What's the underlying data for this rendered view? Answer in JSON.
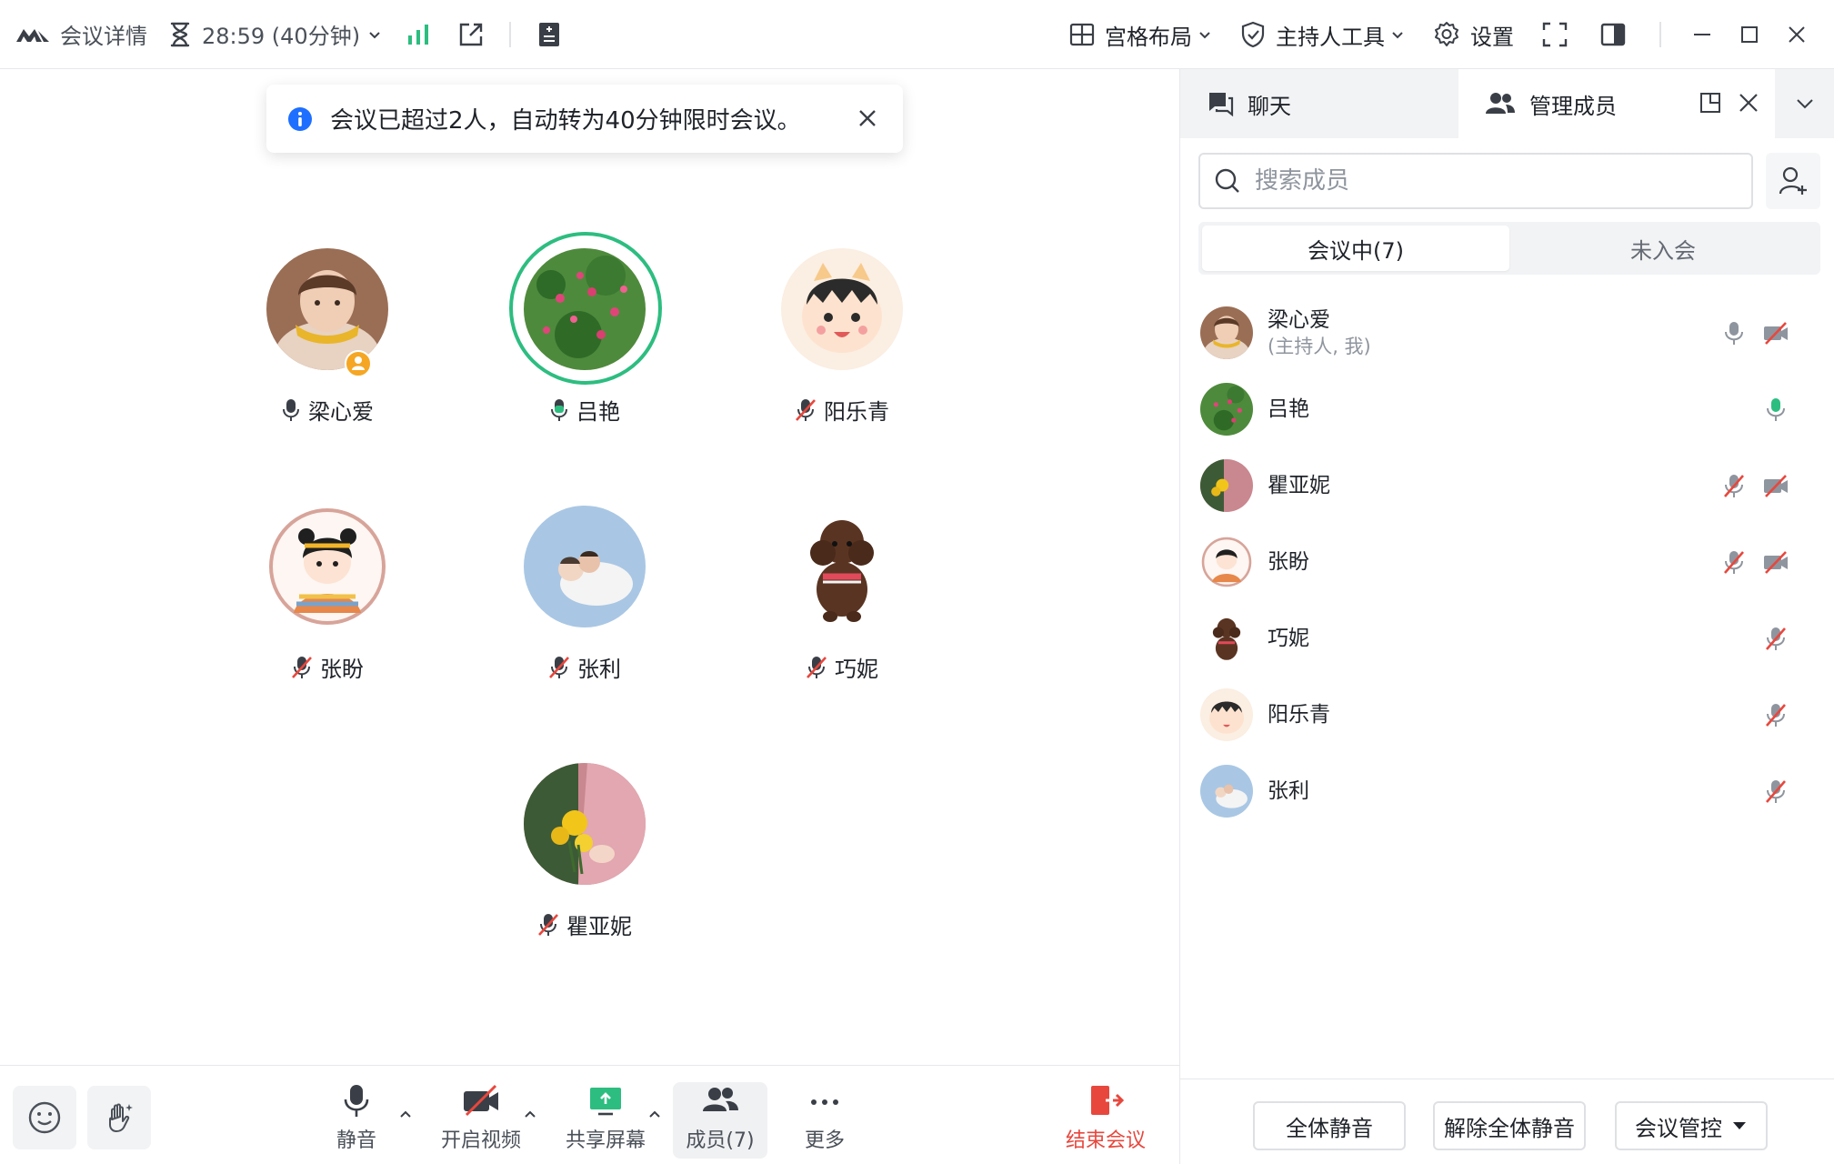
{
  "topbar": {
    "meeting_details": "会议详情",
    "timer": "28:59 (40分钟)",
    "layout": "宫格布局",
    "host_tools": "主持人工具",
    "settings": "设置"
  },
  "notification": {
    "text": "会议已超过2人，自动转为40分钟限时会议。"
  },
  "tiles": [
    {
      "name": "梁心爱",
      "mic": "on",
      "host": true
    },
    {
      "name": "吕艳",
      "mic": "on",
      "speaking": true
    },
    {
      "name": "阳乐青",
      "mic": "muted"
    },
    {
      "name": "张盼",
      "mic": "muted"
    },
    {
      "name": "张利",
      "mic": "muted"
    },
    {
      "name": "巧妮",
      "mic": "muted"
    },
    {
      "name": "瞿亚妮",
      "mic": "muted"
    }
  ],
  "toolbar": {
    "mute": "静音",
    "start_video": "开启视频",
    "share_screen": "共享屏幕",
    "members": "成员(7)",
    "more": "更多",
    "end_meeting": "结束会议"
  },
  "panel": {
    "tab_chat": "聊天",
    "tab_members": "管理成员",
    "search_placeholder": "搜索成员",
    "seg_in_meeting": "会议中(7)",
    "seg_not_joined": "未入会",
    "members": [
      {
        "name": "梁心爱",
        "sub": "(主持人, 我)",
        "mic": "idle",
        "video": "off"
      },
      {
        "name": "吕艳",
        "mic": "active"
      },
      {
        "name": "瞿亚妮",
        "mic": "muted",
        "video": "off"
      },
      {
        "name": "张盼",
        "mic": "muted",
        "video": "off"
      },
      {
        "name": "巧妮",
        "mic": "muted"
      },
      {
        "name": "阳乐青",
        "mic": "muted"
      },
      {
        "name": "张利",
        "mic": "muted"
      }
    ],
    "mute_all": "全体静音",
    "unmute_all": "解除全体静音",
    "meeting_control": "会议管控"
  },
  "colors": {
    "accent_green": "#2dbd80",
    "mute_red": "#e8473d",
    "end_red": "#e8473d",
    "info_blue": "#1e6fff",
    "host_badge": "#f5a623"
  }
}
